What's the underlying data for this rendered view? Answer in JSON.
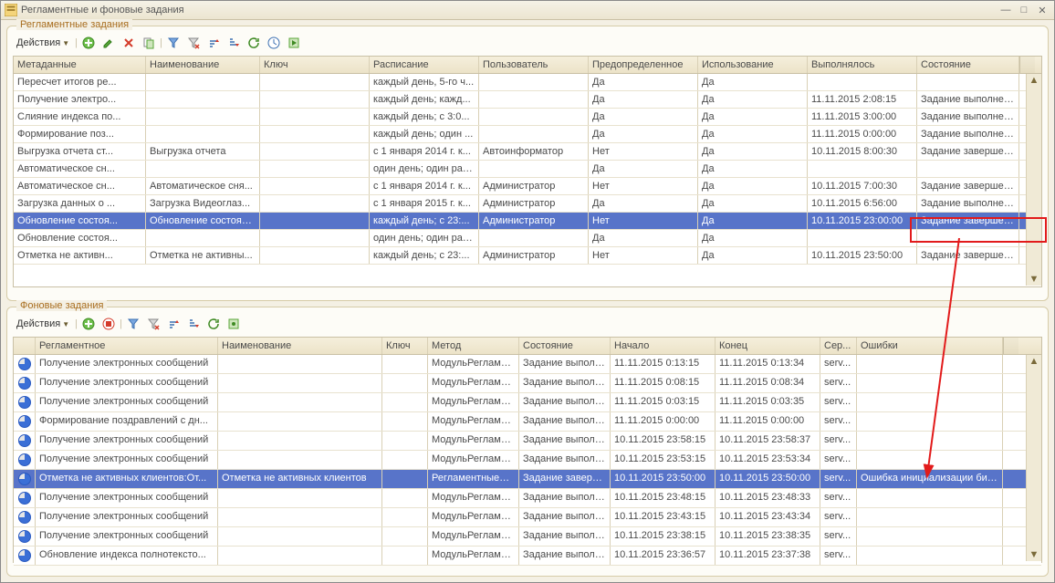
{
  "window": {
    "title": "Регламентные и фоновые задания"
  },
  "panel1": {
    "title": "Регламентные задания",
    "actions_label": "Действия",
    "columns": [
      "Метаданные",
      "Наименование",
      "Ключ",
      "Расписание",
      "Пользователь",
      "Предопределенное",
      "Использование",
      "Выполнялось",
      "Состояние"
    ],
    "rows": [
      {
        "c": [
          "Пересчет итогов ре...",
          "",
          "",
          "каждый  день, 5-го ч...",
          "",
          "Да",
          "Да",
          "",
          ""
        ]
      },
      {
        "c": [
          "Получение электро...",
          "",
          "",
          "каждый  день; кажд...",
          "",
          "Да",
          "Да",
          "11.11.2015 2:08:15",
          "Задание выполнено"
        ]
      },
      {
        "c": [
          "Слияние индекса по...",
          "",
          "",
          "каждый  день; с 3:0...",
          "",
          "Да",
          "Да",
          "11.11.2015 3:00:00",
          "Задание выполнено"
        ]
      },
      {
        "c": [
          "Формирование поз...",
          "",
          "",
          "каждый  день; один ...",
          "",
          "Да",
          "Да",
          "11.11.2015 0:00:00",
          "Задание выполнено"
        ]
      },
      {
        "c": [
          "Выгрузка отчета ст...",
          "Выгрузка отчета",
          "",
          "с 1 января 2014 г. к...",
          "Автоинформатор",
          "Нет",
          "Да",
          "10.11.2015 8:00:30",
          "Задание завершено ..."
        ]
      },
      {
        "c": [
          "Автоматическое сн...",
          "",
          "",
          "один день; один раз...",
          "",
          "Да",
          "Да",
          "",
          ""
        ]
      },
      {
        "c": [
          "Автоматическое сн...",
          "Автоматическое сня...",
          "",
          "с 1 января 2014 г. к...",
          "Администратор",
          "Нет",
          "Да",
          "10.11.2015 7:00:30",
          "Задание завершено ..."
        ]
      },
      {
        "c": [
          "Загрузка данных о ...",
          "Загрузка Видеоглаз...",
          "",
          "с 1 января 2015 г. к...",
          "Администратор",
          "Да",
          "Да",
          "10.11.2015 6:56:00",
          "Задание выполнено"
        ]
      },
      {
        "c": [
          "Обновление состоя...",
          "Обновление состоян...",
          "",
          "каждый  день; с 23:...",
          "Администратор",
          "Нет",
          "Да",
          "10.11.2015 23:00:00",
          "Задание завершено ..."
        ],
        "sel": true
      },
      {
        "c": [
          "Обновление состоя...",
          "",
          "",
          "один день; один раз...",
          "",
          "Да",
          "Да",
          "",
          ""
        ]
      },
      {
        "c": [
          "Отметка не активн...",
          "Отметка не активны...",
          "",
          "каждый  день; с 23:...",
          "Администратор",
          "Нет",
          "Да",
          "10.11.2015 23:50:00",
          "Задание завершено ..."
        ]
      }
    ]
  },
  "panel2": {
    "title": "Фоновые задания",
    "actions_label": "Действия",
    "columns": [
      "",
      "Регламентное",
      "Наименование",
      "Ключ",
      "Метод",
      "Состояние",
      "Начало",
      "Конец",
      "Сер...",
      "Ошибки"
    ],
    "rows": [
      {
        "c": [
          "Получение электронных сообщений",
          "",
          "",
          "МодульРегламен...",
          "Задание выполне...",
          "11.11.2015 0:13:15",
          "11.11.2015 0:13:34",
          "serv...",
          ""
        ]
      },
      {
        "c": [
          "Получение электронных сообщений",
          "",
          "",
          "МодульРегламен...",
          "Задание выполне...",
          "11.11.2015 0:08:15",
          "11.11.2015 0:08:34",
          "serv...",
          ""
        ]
      },
      {
        "c": [
          "Получение электронных сообщений",
          "",
          "",
          "МодульРегламен...",
          "Задание выполне...",
          "11.11.2015 0:03:15",
          "11.11.2015 0:03:35",
          "serv...",
          ""
        ]
      },
      {
        "c": [
          "Формирование поздравлений с дн...",
          "",
          "",
          "МодульРегламен...",
          "Задание выполне...",
          "11.11.2015 0:00:00",
          "11.11.2015 0:00:00",
          "serv...",
          ""
        ]
      },
      {
        "c": [
          "Получение электронных сообщений",
          "",
          "",
          "МодульРегламен...",
          "Задание выполне...",
          "10.11.2015 23:58:15",
          "10.11.2015 23:58:37",
          "serv...",
          ""
        ]
      },
      {
        "c": [
          "Получение электронных сообщений",
          "",
          "",
          "МодульРегламен...",
          "Задание выполне...",
          "10.11.2015 23:53:15",
          "10.11.2015 23:53:34",
          "serv...",
          ""
        ]
      },
      {
        "c": [
          "Отметка не активных клиентов:От...",
          "Отметка не активных клиентов",
          "",
          "РегламентныеЗа...",
          "Задание заверш...",
          "10.11.2015 23:50:00",
          "10.11.2015 23:50:00",
          "serv...",
          "Ошибка инициализации библи..."
        ],
        "sel": true
      },
      {
        "c": [
          "Получение электронных сообщений",
          "",
          "",
          "МодульРегламен...",
          "Задание выполне...",
          "10.11.2015 23:48:15",
          "10.11.2015 23:48:33",
          "serv...",
          ""
        ]
      },
      {
        "c": [
          "Получение электронных сообщений",
          "",
          "",
          "МодульРегламен...",
          "Задание выполне...",
          "10.11.2015 23:43:15",
          "10.11.2015 23:43:34",
          "serv...",
          ""
        ]
      },
      {
        "c": [
          "Получение электронных сообщений",
          "",
          "",
          "МодульРегламен...",
          "Задание выполне...",
          "10.11.2015 23:38:15",
          "10.11.2015 23:38:35",
          "serv...",
          ""
        ]
      },
      {
        "c": [
          "Обновление индекса полнотексто...",
          "",
          "",
          "МодульРегламен...",
          "Задание выполне...",
          "10.11.2015 23:36:57",
          "10.11.2015 23:37:38",
          "serv...",
          ""
        ]
      }
    ]
  }
}
